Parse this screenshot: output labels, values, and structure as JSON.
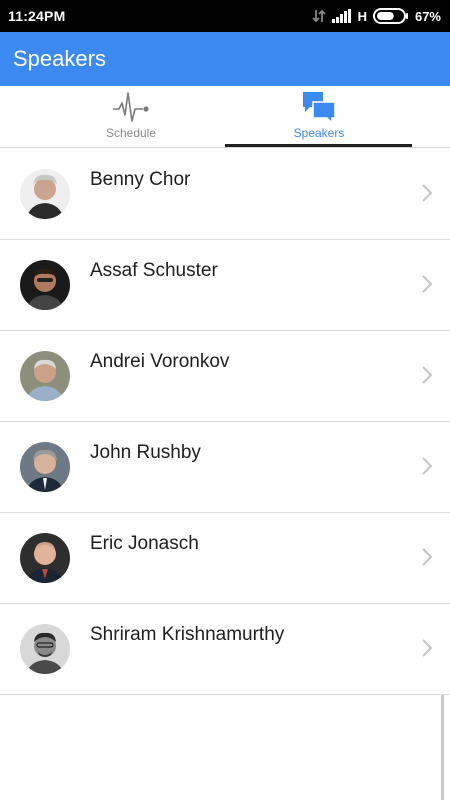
{
  "status_bar": {
    "time": "11:24PM",
    "network_type": "H",
    "battery_percent": "67%",
    "battery_level": 0.67,
    "icons": [
      "data-transfer-icon",
      "signal-icon",
      "battery-icon"
    ]
  },
  "app_bar": {
    "title": "Speakers"
  },
  "tabs": [
    {
      "label": "Schedule",
      "icon": "pulse-icon",
      "selected": false
    },
    {
      "label": "Speakers",
      "icon": "chat-bubbles-icon",
      "selected": true
    }
  ],
  "speakers": [
    {
      "name": "Benny Chor",
      "avatar": "avatar-photo"
    },
    {
      "name": "Assaf Schuster",
      "avatar": "avatar-photo"
    },
    {
      "name": "Andrei Voronkov",
      "avatar": "avatar-photo"
    },
    {
      "name": "John Rushby",
      "avatar": "avatar-photo"
    },
    {
      "name": "Eric Jonasch",
      "avatar": "avatar-photo"
    },
    {
      "name": "Shriram Krishnamurthy",
      "avatar": "avatar-photo"
    }
  ],
  "colors": {
    "primary": "#3d89f2",
    "status_bar": "#000000",
    "tab_indicator": "#222222",
    "divider": "#dcdcdc"
  }
}
